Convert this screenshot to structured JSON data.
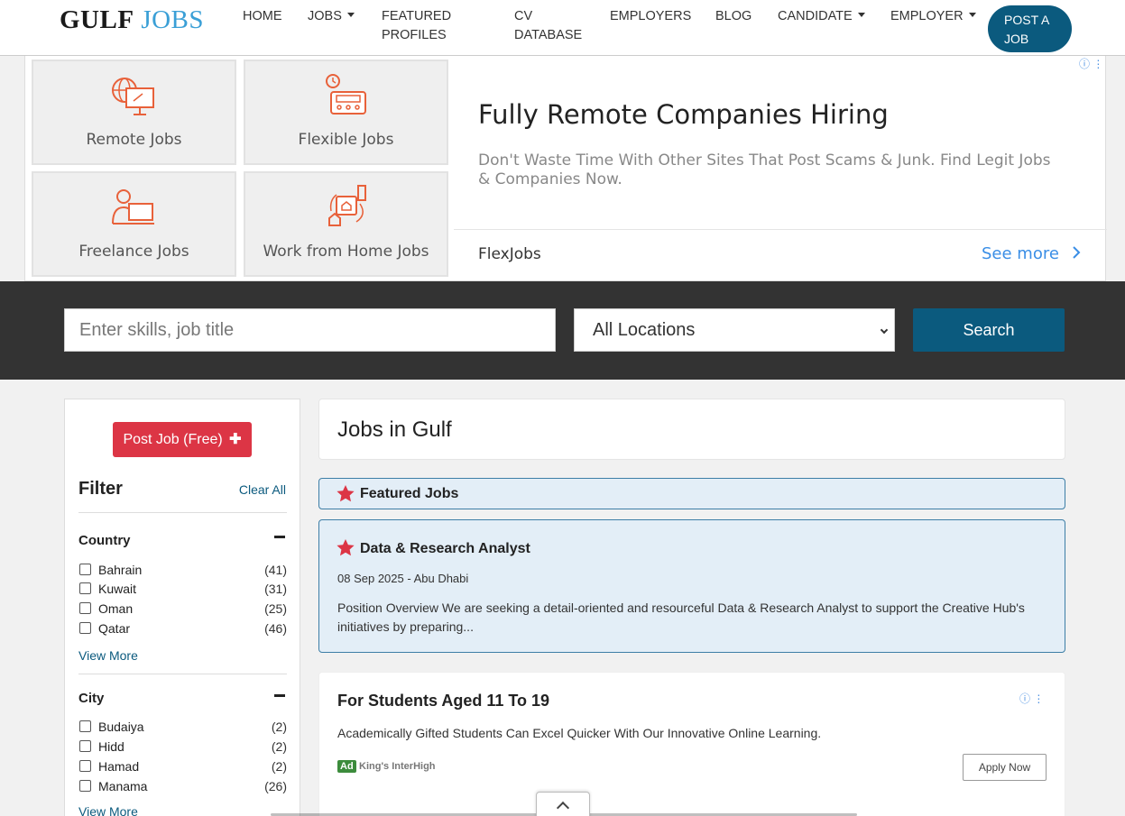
{
  "header": {
    "logo_part1": "GULF",
    "logo_part2": "JOBS",
    "nav": {
      "home": "HOME",
      "jobs": "JOBS",
      "featured_line1": "FEATURED",
      "featured_line2": "PROFILES",
      "cv_line1": "CV",
      "cv_line2": "DATABASE",
      "employers": "EMPLOYERS",
      "blog": "BLOG",
      "candidate": "CANDIDATE",
      "employer": "EMPLOYER"
    },
    "post_line1": "POST A",
    "post_line2": "JOB"
  },
  "ad_top": {
    "tiles": [
      "Remote Jobs",
      "Flexible Jobs",
      "Freelance Jobs",
      "Work from Home Jobs"
    ],
    "title": "Fully Remote Companies Hiring",
    "description": "Don't Waste Time With Other Sites That Post Scams & Junk. Find Legit Jobs & Companies Now.",
    "brand": "FlexJobs",
    "see_more": "See more",
    "accent_color": "#e8613a"
  },
  "search": {
    "placeholder": "Enter skills, job title",
    "location": "All Locations",
    "button": "Search"
  },
  "sidebar": {
    "post_job": "Post Job (Free)",
    "filter_title": "Filter",
    "clear_all": "Clear All",
    "country": {
      "title": "Country",
      "items": [
        {
          "name": "Bahrain",
          "count": "(41)"
        },
        {
          "name": "Kuwait",
          "count": "(31)"
        },
        {
          "name": "Oman",
          "count": "(25)"
        },
        {
          "name": "Qatar",
          "count": "(46)"
        }
      ],
      "view_more": "View More"
    },
    "city": {
      "title": "City",
      "items": [
        {
          "name": "Budaiya",
          "count": "(2)"
        },
        {
          "name": "Hidd",
          "count": "(2)"
        },
        {
          "name": "Hamad",
          "count": "(2)"
        },
        {
          "name": "Manama",
          "count": "(26)"
        }
      ],
      "view_more": "View More"
    }
  },
  "main": {
    "title": "Jobs in Gulf",
    "featured_label": "Featured Jobs",
    "job": {
      "title": "Data & Research Analyst",
      "meta": "08 Sep 2025 - Abu Dhabi",
      "description": "Position Overview We are seeking a detail-oriented and resourceful Data & Research Analyst to support the Creative Hub's initiatives by preparing..."
    },
    "ad": {
      "title": "For Students Aged 11 To 19",
      "description": "Academically Gifted Students Can Excel Quicker With Our Innovative Online Learning.",
      "badge": "Ad",
      "sponsor": "King's InterHigh",
      "apply": "Apply Now"
    }
  },
  "colors": {
    "brand_blue": "#0b5a7e",
    "post_red": "#dc3545",
    "star_red": "#dc3545",
    "featured_bg": "#e3eef7"
  }
}
